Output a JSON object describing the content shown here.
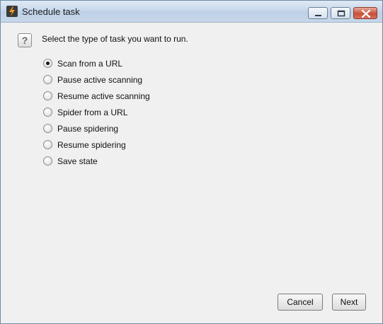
{
  "window": {
    "title": "Schedule task",
    "icons": {
      "app": "lightning-app-icon",
      "minimize": "minimize-icon",
      "maximize": "maximize-icon",
      "close": "close-icon"
    }
  },
  "dialog": {
    "help_icon_glyph": "?",
    "prompt": "Select the type of task you want to run.",
    "options": [
      {
        "label": "Scan from a URL",
        "selected": true
      },
      {
        "label": "Pause active scanning",
        "selected": false
      },
      {
        "label": "Resume active scanning",
        "selected": false
      },
      {
        "label": "Spider from a URL",
        "selected": false
      },
      {
        "label": "Pause spidering",
        "selected": false
      },
      {
        "label": "Resume spidering",
        "selected": false
      },
      {
        "label": "Save state",
        "selected": false
      }
    ]
  },
  "buttons": {
    "cancel_label": "Cancel",
    "next_label": "Next"
  }
}
